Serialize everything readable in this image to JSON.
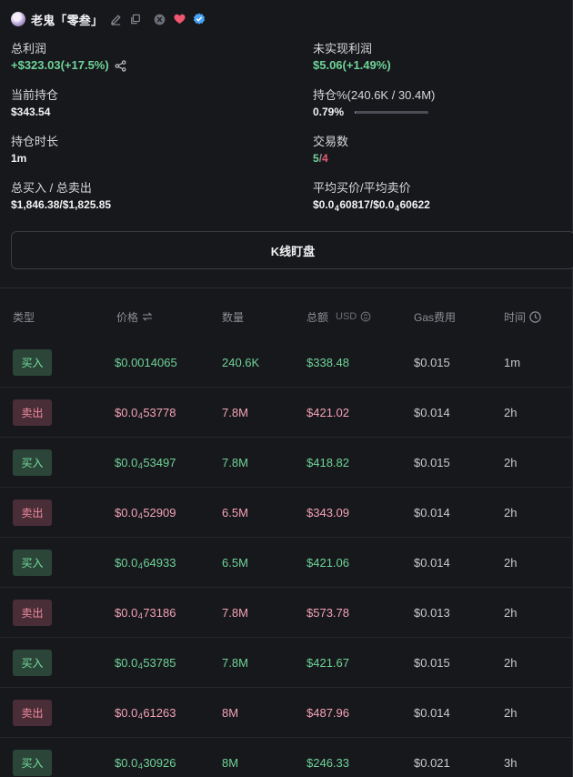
{
  "header": {
    "username": "老鬼「零叁」",
    "icons": [
      "avatar",
      "edit-icon",
      "copy-icon",
      "x-icon",
      "heart-icon",
      "verified-icon"
    ]
  },
  "stats": {
    "total_profit": {
      "label": "总利润",
      "value": "+$323.03(+17.5%)"
    },
    "unrealized": {
      "label": "未实现利润",
      "value": "$5.06(+1.49%)"
    },
    "holding": {
      "label": "当前持仓",
      "value": "$343.54"
    },
    "position_pct": {
      "label": "持仓%(240.6K / 30.4M)",
      "value": "0.79%",
      "progress": 0.0079
    },
    "hold_time": {
      "label": "持仓时长",
      "value": "1m"
    },
    "trade_count": {
      "label": "交易数",
      "buys": "5",
      "sep": "/",
      "sells": "4"
    },
    "buy_sell_total": {
      "label": "总买入 / 总卖出",
      "value": "$1,846.38/$1,825.85"
    },
    "avg_price": {
      "label": "平均买价/平均卖价",
      "buy_prefix": "$0.0",
      "buy_zeros": "4",
      "buy_digits": "60817",
      "sep": "/$0.0",
      "sell_zeros": "4",
      "sell_digits": "60622"
    }
  },
  "kline_button": "K线盯盘",
  "table": {
    "headers": {
      "type": "类型",
      "price": "价格",
      "qty": "数量",
      "total": "总额",
      "total_unit": "USD",
      "gas": "Gas费用",
      "time": "时间"
    },
    "rows": [
      {
        "type": "买入",
        "side": "buy",
        "price_full": "$0.0014065",
        "qty": "240.6K",
        "total": "$338.48",
        "gas": "$0.015",
        "time": "1m"
      },
      {
        "type": "卖出",
        "side": "sell",
        "price_prefix": "$0.0",
        "zeros": "4",
        "digits": "53778",
        "qty": "7.8M",
        "total": "$421.02",
        "gas": "$0.014",
        "time": "2h"
      },
      {
        "type": "买入",
        "side": "buy",
        "price_prefix": "$0.0",
        "zeros": "4",
        "digits": "53497",
        "qty": "7.8M",
        "total": "$418.82",
        "gas": "$0.015",
        "time": "2h"
      },
      {
        "type": "卖出",
        "side": "sell",
        "price_prefix": "$0.0",
        "zeros": "4",
        "digits": "52909",
        "qty": "6.5M",
        "total": "$343.09",
        "gas": "$0.014",
        "time": "2h"
      },
      {
        "type": "买入",
        "side": "buy",
        "price_prefix": "$0.0",
        "zeros": "4",
        "digits": "64933",
        "qty": "6.5M",
        "total": "$421.06",
        "gas": "$0.014",
        "time": "2h"
      },
      {
        "type": "卖出",
        "side": "sell",
        "price_prefix": "$0.0",
        "zeros": "4",
        "digits": "73186",
        "qty": "7.8M",
        "total": "$573.78",
        "gas": "$0.013",
        "time": "2h"
      },
      {
        "type": "买入",
        "side": "buy",
        "price_prefix": "$0.0",
        "zeros": "4",
        "digits": "53785",
        "qty": "7.8M",
        "total": "$421.67",
        "gas": "$0.015",
        "time": "2h"
      },
      {
        "type": "卖出",
        "side": "sell",
        "price_prefix": "$0.0",
        "zeros": "4",
        "digits": "61263",
        "qty": "8M",
        "total": "$487.96",
        "gas": "$0.014",
        "time": "2h"
      },
      {
        "type": "买入",
        "side": "buy",
        "price_prefix": "$0.0",
        "zeros": "4",
        "digits": "30926",
        "qty": "8M",
        "total": "$246.33",
        "gas": "$0.021",
        "time": "3h"
      }
    ]
  },
  "colors": {
    "background": "#17181b",
    "green": "#6fd39a",
    "red": "#ee5b6f",
    "pink": "#f4a2b7",
    "buy_badge": "#2b4638",
    "sell_badge": "#4a2e37"
  }
}
